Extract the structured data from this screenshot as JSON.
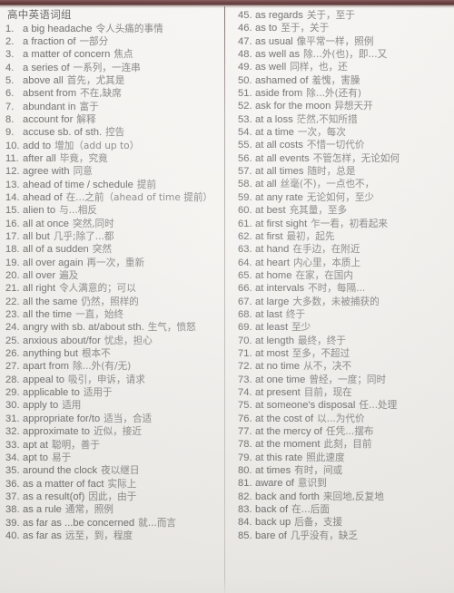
{
  "document": {
    "title": "高中英语词组",
    "accent_color": "#5e2f30",
    "background_color": "#f3f1ee",
    "text_color": "#6b6b6b"
  },
  "columns": [
    {
      "name": "left-column",
      "items": [
        {
          "num": "1.",
          "en": "a big headache",
          "zh": "令人头痛的事情"
        },
        {
          "num": "2.",
          "en": "a fraction of",
          "zh": "一部分"
        },
        {
          "num": "3.",
          "en": "a matter of concern",
          "zh": "焦点"
        },
        {
          "num": "4.",
          "en": "a series of",
          "zh": "一系列，一连串"
        },
        {
          "num": "5.",
          "en": "above all",
          "zh": "首先，尤其是"
        },
        {
          "num": "6.",
          "en": "absent from",
          "zh": "不在,缺席"
        },
        {
          "num": "7.",
          "en": "abundant in",
          "zh": "富于"
        },
        {
          "num": "8.",
          "en": "account for",
          "zh": "解释"
        },
        {
          "num": "9.",
          "en": "accuse sb. of sth.",
          "zh": "控告"
        },
        {
          "num": "10.",
          "en": "add to",
          "zh": "增加（add up to）"
        },
        {
          "num": "11.",
          "en": "after all",
          "zh": "毕竟，究竟"
        },
        {
          "num": "12.",
          "en": "agree with",
          "zh": "同意"
        },
        {
          "num": "13.",
          "en": "ahead of time / schedule",
          "zh": "提前"
        },
        {
          "num": "14.",
          "en": "ahead of",
          "zh": "在...之前（ahead of time 提前）"
        },
        {
          "num": "15.",
          "en": "alien to",
          "zh": "与...相反"
        },
        {
          "num": "16.",
          "en": "all at once",
          "zh": "突然,同时"
        },
        {
          "num": "17.",
          "en": "all but",
          "zh": "几乎;除了...都"
        },
        {
          "num": "18.",
          "en": "all of a sudden",
          "zh": "突然"
        },
        {
          "num": "19.",
          "en": "all over again",
          "zh": "再一次，重新"
        },
        {
          "num": "20.",
          "en": "all over",
          "zh": "遍及"
        },
        {
          "num": "21.",
          "en": "all right",
          "zh": "令人满意的；可以"
        },
        {
          "num": "22.",
          "en": "all the same",
          "zh": "仍然，照样的"
        },
        {
          "num": "23.",
          "en": "all the time",
          "zh": "一直，始终"
        },
        {
          "num": "24.",
          "en": "angry with sb. at/about sth.",
          "zh": "生气，愤怒"
        },
        {
          "num": "25.",
          "en": "anxious about/for",
          "zh": "忧虑，担心"
        },
        {
          "num": "26.",
          "en": "anything but",
          "zh": "根本不"
        },
        {
          "num": "27.",
          "en": "apart from",
          "zh": "除...外(有/无)"
        },
        {
          "num": "28.",
          "en": "appeal to",
          "zh": "吸引，申诉，请求"
        },
        {
          "num": "29.",
          "en": "applicable to",
          "zh": "适用于"
        },
        {
          "num": "30.",
          "en": "apply to",
          "zh": "适用"
        },
        {
          "num": "31.",
          "en": "appropriate for/to",
          "zh": "适当，合适"
        },
        {
          "num": "32.",
          "en": "approximate to",
          "zh": "近似，接近"
        },
        {
          "num": "33.",
          "en": "apt at",
          "zh": "聪明，善于"
        },
        {
          "num": "34.",
          "en": "apt to",
          "zh": "易于"
        },
        {
          "num": "35.",
          "en": "around the clock",
          "zh": "夜以继日"
        },
        {
          "num": "36.",
          "en": "as a matter of fact",
          "zh": "实际上"
        },
        {
          "num": "37.",
          "en": "as a result(of)",
          "zh": "因此，由于"
        },
        {
          "num": "38.",
          "en": "as a rule",
          "zh": "通常，照例"
        },
        {
          "num": "39.",
          "en": "as far as ...be concerned",
          "zh": "就...而言"
        },
        {
          "num": "40.",
          "en": "as far as",
          "zh": "远至，到，程度"
        }
      ]
    },
    {
      "name": "right-column",
      "items": [
        {
          "num": "45.",
          "en": "as regards",
          "zh": "关于，至于"
        },
        {
          "num": "46.",
          "en": "as to",
          "zh": "至于，关于"
        },
        {
          "num": "47.",
          "en": "as usual",
          "zh": "像平常一样，照例"
        },
        {
          "num": "48.",
          "en": "as well as",
          "zh": "除...外(也)，即...又"
        },
        {
          "num": "49.",
          "en": "as well",
          "zh": "同样，也，还"
        },
        {
          "num": "50.",
          "en": "ashamed of",
          "zh": "羞愧，害臊"
        },
        {
          "num": "51.",
          "en": "aside from",
          "zh": "除...外(还有)"
        },
        {
          "num": "52.",
          "en": "ask for the moon",
          "zh": "异想天开"
        },
        {
          "num": "53.",
          "en": "at a loss",
          "zh": "茫然,不知所措"
        },
        {
          "num": "54.",
          "en": "at a time",
          "zh": "一次，每次"
        },
        {
          "num": "55.",
          "en": "at all costs",
          "zh": "不惜一切代价"
        },
        {
          "num": "56.",
          "en": "at all events",
          "zh": "不管怎样，无论如何"
        },
        {
          "num": "57.",
          "en": "at all times",
          "zh": "随时，总是"
        },
        {
          "num": "58.",
          "en": "at all",
          "zh": "丝毫(不)，一点也不，"
        },
        {
          "num": "59.",
          "en": "at any rate",
          "zh": "无论如何，至少"
        },
        {
          "num": "60.",
          "en": "at best",
          "zh": "充其量，至多"
        },
        {
          "num": "61.",
          "en": "at first sight",
          "zh": "乍一看，初看起来"
        },
        {
          "num": "62.",
          "en": "at first",
          "zh": "最初，起先"
        },
        {
          "num": "63.",
          "en": "at hand",
          "zh": "在手边，在附近"
        },
        {
          "num": "64.",
          "en": "at heart",
          "zh": "内心里，本质上"
        },
        {
          "num": "65.",
          "en": "at home",
          "zh": "在家，在国内"
        },
        {
          "num": "66.",
          "en": "at intervals",
          "zh": "不时，每隔..."
        },
        {
          "num": "67.",
          "en": "at large",
          "zh": "大多数，未被捕获的"
        },
        {
          "num": "68.",
          "en": "at last",
          "zh": "终于"
        },
        {
          "num": "69.",
          "en": "at least",
          "zh": "至少"
        },
        {
          "num": "70.",
          "en": "at length",
          "zh": "最终，终于"
        },
        {
          "num": "71.",
          "en": "at most",
          "zh": "至多，不超过"
        },
        {
          "num": "72.",
          "en": "at no time",
          "zh": "从不，决不"
        },
        {
          "num": "73.",
          "en": "at one time",
          "zh": "曾经，一度；同时"
        },
        {
          "num": "74.",
          "en": "at present",
          "zh": "目前，现在"
        },
        {
          "num": "75.",
          "en": "at someone's disposal",
          "zh": "任...处理"
        },
        {
          "num": "76.",
          "en": "at the cost of",
          "zh": "以...为代价"
        },
        {
          "num": "77.",
          "en": "at the mercy of",
          "zh": "任凭...摆布"
        },
        {
          "num": "78.",
          "en": "at the moment",
          "zh": "此刻，目前"
        },
        {
          "num": "79.",
          "en": "at this rate",
          "zh": "照此速度"
        },
        {
          "num": "80.",
          "en": "at times",
          "zh": "有时，间或"
        },
        {
          "num": "81.",
          "en": "aware of",
          "zh": "意识到"
        },
        {
          "num": "82.",
          "en": "back and forth",
          "zh": "来回地,反复地"
        },
        {
          "num": "83.",
          "en": "back of",
          "zh": "在...后面"
        },
        {
          "num": "84.",
          "en": "back up",
          "zh": "后备，支援"
        },
        {
          "num": "85.",
          "en": "bare of",
          "zh": "几乎没有，缺乏"
        }
      ]
    }
  ]
}
